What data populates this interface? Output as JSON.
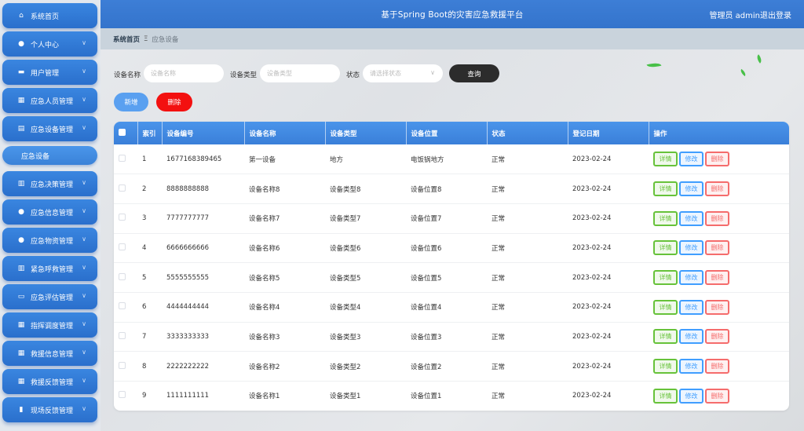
{
  "header": {
    "title": "基于Spring Boot的灾害应急救援平台",
    "admin": "管理员 admin",
    "logout": "退出登录"
  },
  "breadcrumb": {
    "home": "系统首页",
    "separator": "Ξ",
    "current": "应急设备"
  },
  "sidebar": {
    "items": [
      {
        "label": "系统首页",
        "icon": "home-icon",
        "glyph": "⌂",
        "chevron": false
      },
      {
        "label": "个人中心",
        "icon": "user-icon",
        "glyph": "●",
        "chevron": true
      },
      {
        "label": "用户管理",
        "icon": "users-icon",
        "glyph": "▬",
        "chevron": true
      },
      {
        "label": "应急人员管理",
        "icon": "grid-icon",
        "glyph": "▦",
        "chevron": true
      },
      {
        "label": "应急设备管理",
        "icon": "briefcase-icon",
        "glyph": "▤",
        "chevron": true
      },
      {
        "label": "应急决策管理",
        "icon": "clipboard-icon",
        "glyph": "▥",
        "chevron": true
      },
      {
        "label": "应急信息管理",
        "icon": "pin-icon",
        "glyph": "●",
        "chevron": true
      },
      {
        "label": "应急物资管理",
        "icon": "user-icon",
        "glyph": "●",
        "chevron": true
      },
      {
        "label": "紧急呼救管理",
        "icon": "clipboard-icon",
        "glyph": "▥",
        "chevron": true
      },
      {
        "label": "应急评估管理",
        "icon": "printer-icon",
        "glyph": "▭",
        "chevron": true
      },
      {
        "label": "指挥调度管理",
        "icon": "grid-icon",
        "glyph": "▦",
        "chevron": true
      },
      {
        "label": "救援信息管理",
        "icon": "grid-icon",
        "glyph": "▦",
        "chevron": true
      },
      {
        "label": "救援反馈管理",
        "icon": "grid-icon",
        "glyph": "▦",
        "chevron": true
      },
      {
        "label": "现场反馈管理",
        "icon": "chart-icon",
        "glyph": "▮",
        "chevron": true
      }
    ],
    "active_sub": "应急设备"
  },
  "search": {
    "name_label": "设备名称",
    "name_placeholder": "设备名称",
    "type_label": "设备类型",
    "type_placeholder": "设备类型",
    "status_label": "状态",
    "status_placeholder": "请选择状态",
    "query_label": "查询"
  },
  "actions": {
    "add": "新增",
    "delete": "删除"
  },
  "table": {
    "columns": [
      "索引",
      "设备编号",
      "设备名称",
      "设备类型",
      "设备位置",
      "状态",
      "登记日期",
      "操作"
    ],
    "op_labels": {
      "detail": "详情",
      "edit": "修改",
      "remove": "删除"
    },
    "rows": [
      {
        "index": "1",
        "code": "1677168389465",
        "name": "第一设备",
        "type": "地方",
        "location": "电饭锅地方",
        "status": "正常",
        "date": "2023-02-24"
      },
      {
        "index": "2",
        "code": "8888888888",
        "name": "设备名称8",
        "type": "设备类型8",
        "location": "设备位置8",
        "status": "正常",
        "date": "2023-02-24"
      },
      {
        "index": "3",
        "code": "7777777777",
        "name": "设备名称7",
        "type": "设备类型7",
        "location": "设备位置7",
        "status": "正常",
        "date": "2023-02-24"
      },
      {
        "index": "4",
        "code": "6666666666",
        "name": "设备名称6",
        "type": "设备类型6",
        "location": "设备位置6",
        "status": "正常",
        "date": "2023-02-24"
      },
      {
        "index": "5",
        "code": "5555555555",
        "name": "设备名称5",
        "type": "设备类型5",
        "location": "设备位置5",
        "status": "正常",
        "date": "2023-02-24"
      },
      {
        "index": "6",
        "code": "4444444444",
        "name": "设备名称4",
        "type": "设备类型4",
        "location": "设备位置4",
        "status": "正常",
        "date": "2023-02-24"
      },
      {
        "index": "7",
        "code": "3333333333",
        "name": "设备名称3",
        "type": "设备类型3",
        "location": "设备位置3",
        "status": "正常",
        "date": "2023-02-24"
      },
      {
        "index": "8",
        "code": "2222222222",
        "name": "设备名称2",
        "type": "设备类型2",
        "location": "设备位置2",
        "status": "正常",
        "date": "2023-02-24"
      },
      {
        "index": "9",
        "code": "1111111111",
        "name": "设备名称1",
        "type": "设备类型1",
        "location": "设备位置1",
        "status": "正常",
        "date": "2023-02-24"
      }
    ]
  }
}
